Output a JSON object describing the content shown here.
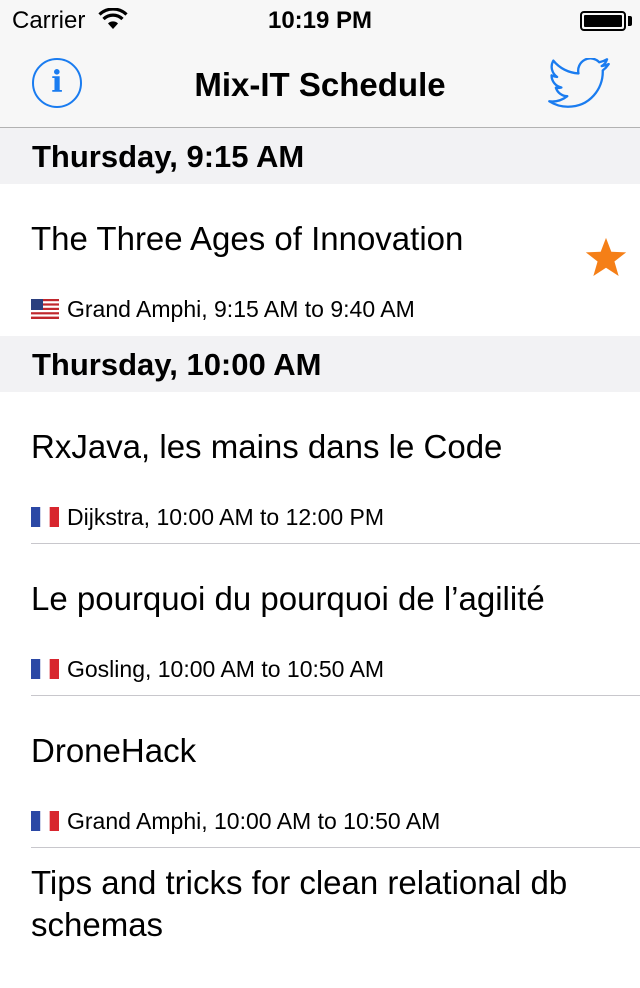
{
  "status_bar": {
    "carrier": "Carrier",
    "time": "10:19 PM"
  },
  "nav": {
    "title": "Mix-IT Schedule",
    "info_icon": "info-icon",
    "twitter_icon": "twitter-icon"
  },
  "colors": {
    "tint": "#1a7cf0",
    "star": "#f57f17",
    "section_bg": "#f2f2f4"
  },
  "sections": [
    {
      "header": "Thursday, 9:15 AM",
      "sessions": [
        {
          "title": "The Three Ages of Innovation",
          "flag": "us",
          "details": "Grand Amphi, 9:15 AM to 9:40 AM",
          "favorite": true
        }
      ]
    },
    {
      "header": "Thursday, 10:00 AM",
      "sessions": [
        {
          "title": "RxJava, les mains dans le Code",
          "flag": "fr",
          "details": "Dijkstra, 10:00 AM to 12:00 PM",
          "favorite": false
        },
        {
          "title": "Le pourquoi du pourquoi de l’agilité",
          "flag": "fr",
          "details": "Gosling, 10:00 AM to 10:50 AM",
          "favorite": false
        },
        {
          "title": "DroneHack",
          "flag": "fr",
          "details": "Grand Amphi, 10:00 AM to 10:50 AM",
          "favorite": false
        },
        {
          "title": "Tips and tricks for clean relational db schemas",
          "flag": "fr",
          "details": "",
          "favorite": false
        }
      ]
    }
  ]
}
